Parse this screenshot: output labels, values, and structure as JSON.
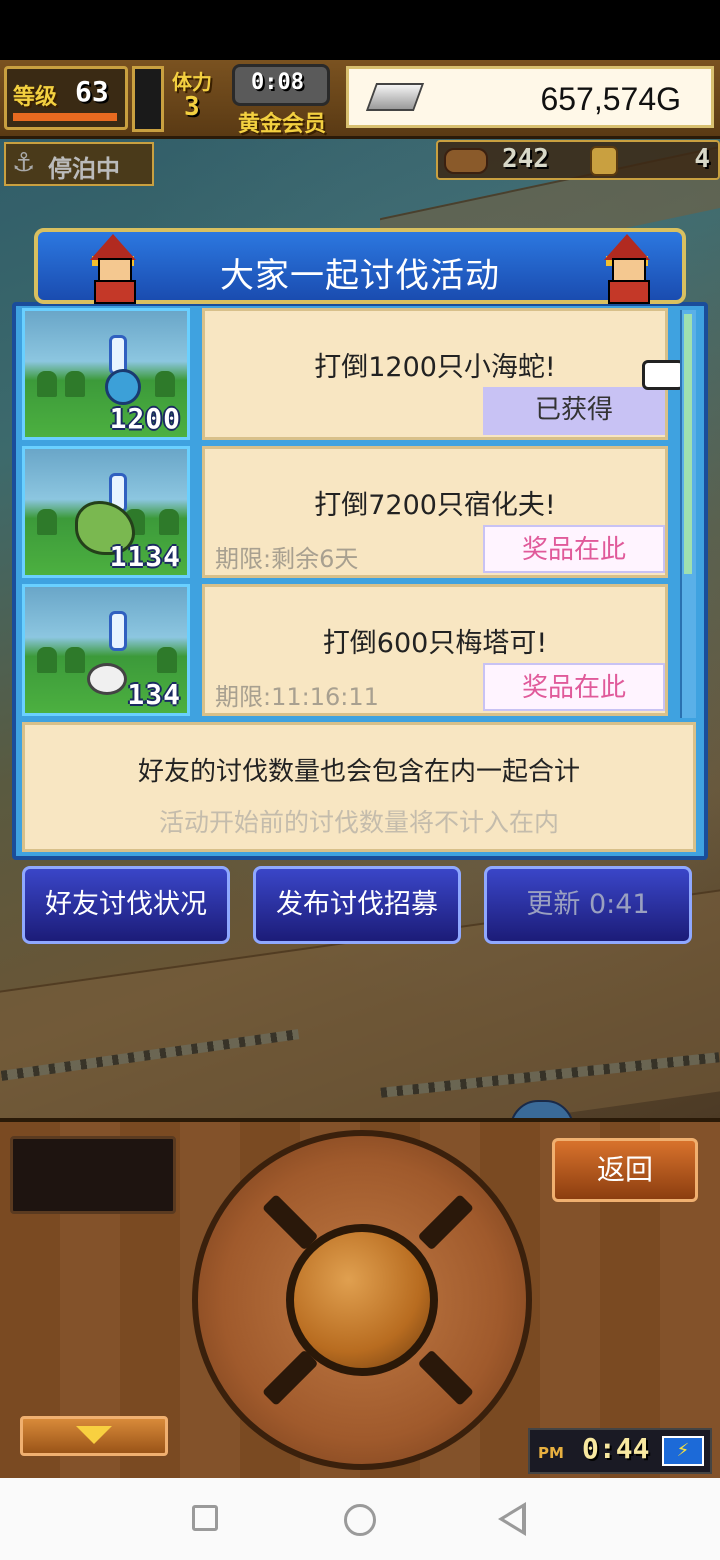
{
  "hud": {
    "level_label": "等级",
    "level_value": "63",
    "stamina_label": "体力",
    "stamina_value": "3",
    "timer": "0:08",
    "membership": "黄金会员",
    "gold": "657,574G",
    "docked": "停泊中",
    "resource_a": "242",
    "resource_b": "4"
  },
  "panel": {
    "title": "大家一起讨伐活动",
    "missions": [
      {
        "title": "打倒1200只小海蛇!",
        "count": "1200",
        "deadline": "",
        "button": "已获得",
        "state": "claimed"
      },
      {
        "title": "打倒7200只宿化夫!",
        "count": "1134",
        "deadline": "期限:剩余6天",
        "button": "奖品在此",
        "state": "prize"
      },
      {
        "title": "打倒600只梅塔可!",
        "count": "134",
        "deadline": "期限:11:16:11",
        "button": "奖品在此",
        "state": "prize"
      }
    ],
    "note_line1": "好友的讨伐数量也会包含在内一起合计",
    "note_line2": "活动开始前的讨伐数量将不计入在内"
  },
  "buttons": {
    "friends_status": "好友讨伐状况",
    "post_recruit": "发布讨伐招募",
    "refresh": "更新 0:41"
  },
  "controls": {
    "back": "返回",
    "clock_ampm": "PM",
    "clock_time": "0:44"
  },
  "colors": {
    "panel_blue": "#3fa2e0",
    "card_cream": "#f8e6c2",
    "prize_pink": "#e05a9a",
    "claimed_lavender": "#c8c2f4"
  }
}
